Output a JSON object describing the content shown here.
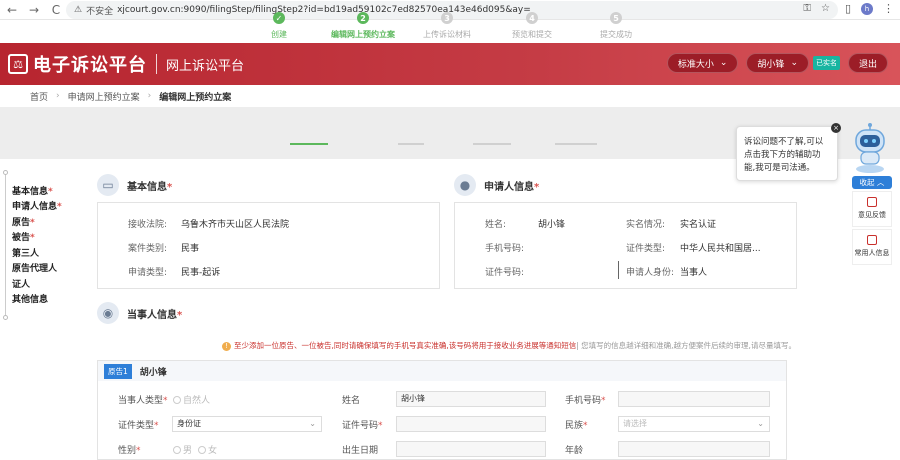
{
  "browser": {
    "back": "←",
    "forward": "→",
    "reload": "C",
    "security_label": "不安全",
    "url": "xjcourt.gov.cn:9090/filingStep/filingStep2?id=bd19ad59102c7ed82570ea143e46d095&ay=",
    "profile_initial": "h"
  },
  "header": {
    "brand": "电子诉讼平台",
    "subtitle": "网上诉讼平台",
    "font_size_btn": "标准大小",
    "user_name": "胡小锋",
    "verified_badge": "已实名",
    "logout": "退出"
  },
  "breadcrumb": {
    "items": [
      "首页",
      "申请网上预约立案",
      "编辑网上预约立案"
    ]
  },
  "steps": [
    {
      "num": "✓",
      "label": "创建",
      "state": "done"
    },
    {
      "num": "2",
      "label": "编辑网上预约立案",
      "state": "active"
    },
    {
      "num": "3",
      "label": "上传诉讼材料",
      "state": "todo"
    },
    {
      "num": "4",
      "label": "预览和提交",
      "state": "todo"
    },
    {
      "num": "5",
      "label": "提交成功",
      "state": "todo"
    }
  ],
  "sidenav": {
    "items": [
      {
        "label": "基本信息",
        "required": "*"
      },
      {
        "label": "申请人信息",
        "required": "*"
      },
      {
        "label": "原告",
        "required": "*"
      },
      {
        "label": "被告",
        "required": "*"
      },
      {
        "label": "第三人",
        "required": ""
      },
      {
        "label": "原告代理人",
        "required": ""
      },
      {
        "label": "证人",
        "required": ""
      },
      {
        "label": "其他信息",
        "required": ""
      }
    ]
  },
  "basic_info": {
    "title": "基本信息",
    "req": "*",
    "court_label": "接收法院:",
    "court_value": "乌鲁木齐市天山区人民法院",
    "case_type_label": "案件类别:",
    "case_type_value": "民事",
    "apply_type_label": "申请类型:",
    "apply_type_value": "民事-起诉"
  },
  "applicant_info": {
    "title": "申请人信息",
    "req": "*",
    "name_label": "姓名:",
    "name_value": "胡小锋",
    "realname_label": "实名情况:",
    "realname_value": "实名认证",
    "phone_label": "手机号码:",
    "idtype_label": "证件类型:",
    "idtype_value": "中华人民共和国居...",
    "idno_label": "证件号码:",
    "identity_label": "申请人身份:",
    "identity_value": "当事人"
  },
  "party_info": {
    "title": "当事人信息",
    "req": "*",
    "notice_main": "至少添加一位原告、一位被告,同时请确保填写的手机号真实准确,该号码将用于接收业务进展等通知短信",
    "notice_extra": "| 您填写的信息越详细和准确,越方便案件后续的审理,请尽量填写。",
    "notice_icon": "!",
    "tag": "原告1",
    "party_name": "胡小锋",
    "party_type_label": "当事人类型",
    "party_type_value": "自然人",
    "name_label": "姓名",
    "name_value": "胡小锋",
    "phone_label": "手机号码",
    "idtype_label": "证件类型",
    "idtype_value": "身份证",
    "idno_label": "证件号码",
    "nation_label": "民族",
    "nation_placeholder": "请选择",
    "gender_label": "性别",
    "gender_male": "男",
    "gender_female": "女",
    "birth_label": "出生日期",
    "age_label": "年龄"
  },
  "assistant": {
    "tip": "诉讼问题不了解,可以点击我下方的辅助功能,我可是司法通。",
    "collapse": "收起",
    "feedback": "意见反馈",
    "common_info": "常用人信息"
  }
}
